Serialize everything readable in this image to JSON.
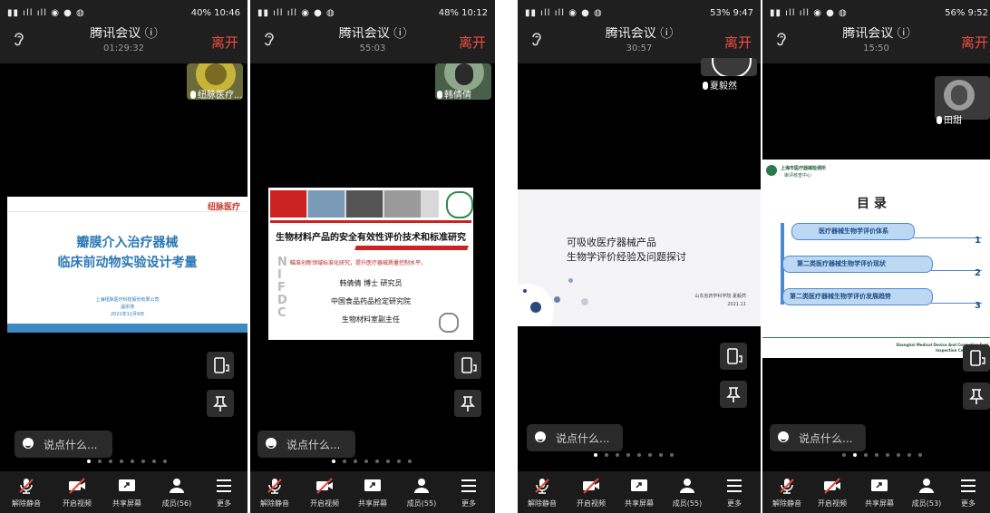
{
  "app": {
    "title": "腾讯会议",
    "info_icon": "ⓘ",
    "leave_label": "离开",
    "chat_placeholder": "说点什么...",
    "toolbar": {
      "unmute": "解除静音",
      "video": "开启视频",
      "share": "共享屏幕",
      "more": "更多"
    },
    "colors": {
      "leave": "#f04d3f",
      "bg": "#000000",
      "bar": "#1f1f1f"
    }
  },
  "screens": [
    {
      "status_right": "40% 10:46",
      "timer": "01:29:32",
      "participant": "纽脉医疗...",
      "members": "成员(56)",
      "slide": {
        "logo": "纽脉医疗",
        "title_line1": "瓣膜介入治疗器械",
        "title_line2": "临床前动物实验设计考量",
        "company": "上海纽脉医疗科技股份有限公司",
        "presenter": "温崇涛",
        "date": "2021年11月9日"
      }
    },
    {
      "status_right": "48% 10:12",
      "timer": "55:03",
      "participant": "韩倩倩",
      "members": "成员(55)",
      "slide": {
        "title": "生物材料产品的安全有效性评价技术和标准研究",
        "subtitle": "瞄准创新领域标准化研究，提升医疗器械质量控制水平。",
        "speaker": "韩倩倩 博士 研究员",
        "org": "中国食品药品检定研究院",
        "dept": "生物材料室副主任",
        "side_letters": "NIFDC"
      }
    },
    {
      "status_right": "53% 9:47",
      "timer": "30:57",
      "participant": "夏毅然",
      "members": "成员(55)",
      "slide": {
        "title_line1": "可吸收医疗器械产品",
        "title_line2": "生物学评价经验及问题探讨",
        "school": "山东省药学科学院  夏毅然",
        "date": "2021.11"
      }
    },
    {
      "status_right": "56% 9:52",
      "timer": "15:50",
      "participant": "田甜",
      "members": "成员(53)",
      "slide": {
        "org_line1": "上海市医疗器械检测所",
        "org_line2": "审评核查中心",
        "heading": "目 录",
        "items": [
          {
            "label": "医疗器械生物学评价体系",
            "num": "1"
          },
          {
            "label": "第二类医疗器械生物学评价现状",
            "num": "2"
          },
          {
            "label": "第二类医疗器械生物学评价发展趋势",
            "num": "3"
          }
        ],
        "footer_line1": "Shanghai Medical Device And Cosmetics Eval",
        "footer_line2": "Inspection Center"
      }
    }
  ]
}
